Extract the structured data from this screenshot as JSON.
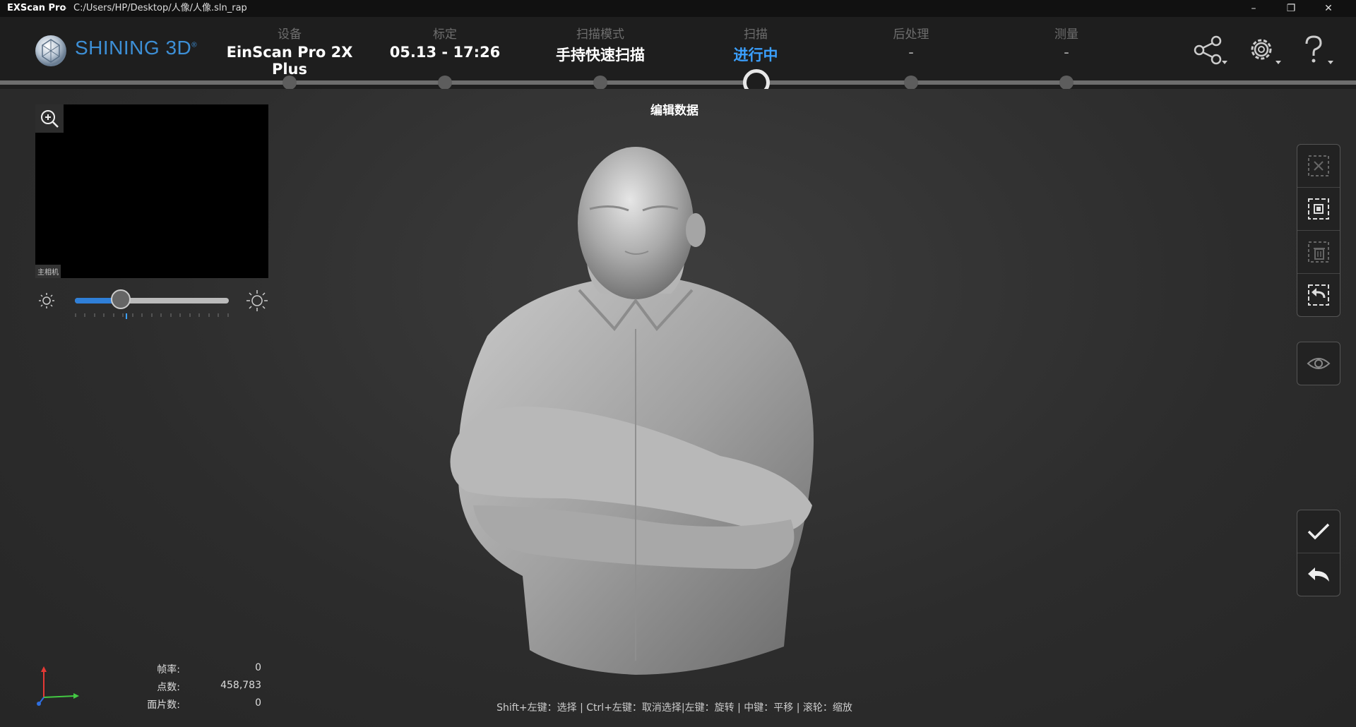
{
  "titlebar": {
    "app_name": "EXScan Pro",
    "separator": "-",
    "path": "C:/Users/HP/Desktop/人像/人像.sln_rap",
    "minimize": "–",
    "restore": "❐",
    "close": "✕"
  },
  "header": {
    "brand": "SHINING 3D",
    "brand_mark": "®",
    "steps": [
      {
        "label": "设备",
        "value": "EinScan Pro 2X Plus"
      },
      {
        "label": "标定",
        "value": "05.13 - 17:26"
      },
      {
        "label": "扫描模式",
        "value": "手持快速扫描"
      },
      {
        "label": "扫描",
        "value": "进行中"
      },
      {
        "label": "后处理",
        "value": "-"
      },
      {
        "label": "测量",
        "value": "-"
      }
    ],
    "current_step_index": 3,
    "accent_color": "#3ba0ff"
  },
  "viewport": {
    "title": "编辑数据",
    "camera_label": "主相机",
    "brightness_level": 0.3,
    "stats": [
      {
        "label": "帧率:",
        "value": "0"
      },
      {
        "label": "点数:",
        "value": "458,783"
      },
      {
        "label": "面片数:",
        "value": "0"
      }
    ],
    "hint": "Shift+左键：选择 | Ctrl+左键：取消选择|左键：旋转 | 中键：平移 | 滚轮：缩放"
  },
  "icons": {
    "share": "share-icon",
    "settings": "gear-icon",
    "help": "help-icon",
    "zoom": "zoom-in-icon",
    "brightness_low": "sun-small-icon",
    "brightness_high": "sun-large-icon",
    "clear_selection": "clear-selection-icon",
    "select_all": "select-all-icon",
    "delete_selection": "delete-selection-icon",
    "invert_selection": "invert-selection-icon",
    "visibility": "eye-icon",
    "confirm": "check-icon",
    "undo": "undo-icon"
  }
}
